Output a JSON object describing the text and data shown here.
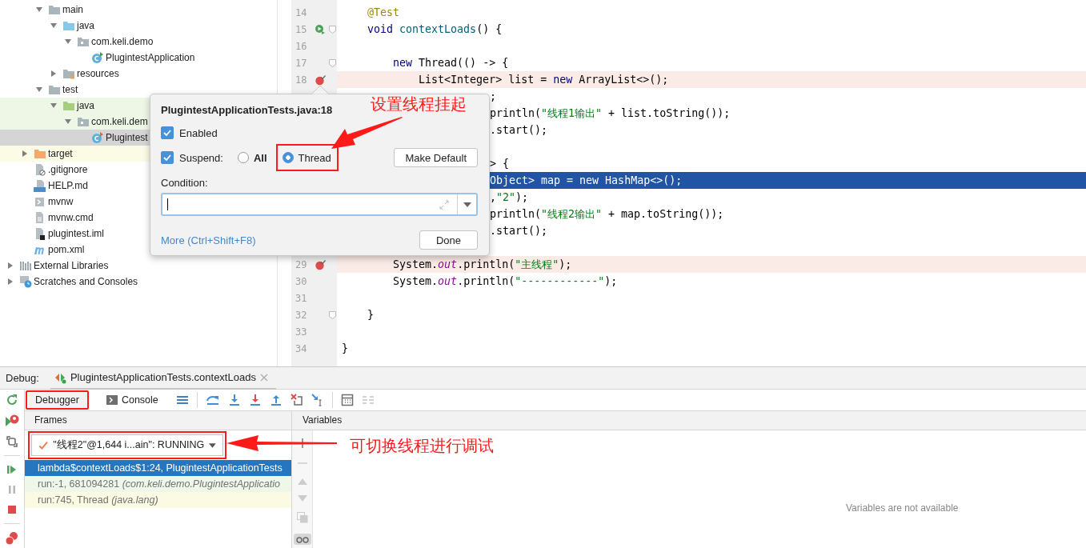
{
  "tree": {
    "src_items": [
      {
        "label": "main",
        "kind": "folder",
        "expanded": true,
        "selected": false,
        "children": [
          {
            "label": "java",
            "kind": "source-folder",
            "expanded": true,
            "selected": false,
            "children": [
              {
                "label": "com.keli.demo",
                "kind": "package",
                "expanded": true,
                "selected": false,
                "children": [
                  {
                    "label": "PlugintestApplication",
                    "kind": "class",
                    "selected": false
                  }
                ]
              }
            ]
          },
          {
            "label": "resources",
            "kind": "resources-folder",
            "expanded": false,
            "selected": false
          }
        ]
      },
      {
        "label": "test",
        "kind": "folder",
        "expanded": true,
        "selected": false,
        "children": [
          {
            "label": "java",
            "kind": "test-folder",
            "expanded": true,
            "selected": false,
            "test_scope": true,
            "children": [
              {
                "label": "com.keli.dem",
                "kind": "package",
                "expanded": true,
                "selected": false,
                "test_scope": true,
                "children": [
                  {
                    "label": "Plugintest",
                    "kind": "test-class",
                    "selected": true
                  }
                ]
              }
            ]
          }
        ]
      }
    ],
    "module_items": [
      {
        "label": "target",
        "kind": "excluded-folder",
        "expanded": false,
        "selected": false,
        "excluded": true
      },
      {
        "label": ".gitignore",
        "kind": "ignore-file",
        "selected": false
      },
      {
        "label": "HELP.md",
        "kind": "markdown",
        "selected": false
      },
      {
        "label": "mvnw",
        "kind": "script",
        "selected": false
      },
      {
        "label": "mvnw.cmd",
        "kind": "text",
        "selected": false
      },
      {
        "label": "plugintest.iml",
        "kind": "module",
        "selected": false
      },
      {
        "label": "pom.xml",
        "kind": "maven",
        "selected": false
      }
    ],
    "root_items": [
      {
        "label": "External Libraries",
        "kind": "library",
        "expanded": false,
        "selected": false
      },
      {
        "label": "Scratches and Consoles",
        "kind": "scratches",
        "expanded": false,
        "selected": false
      }
    ]
  },
  "editor": {
    "lines": [
      {
        "number": "14",
        "code": [
          {
            "text": "    @Test",
            "kind": "ann"
          }
        ]
      },
      {
        "number": "15",
        "run_marker": true,
        "fold": true,
        "code": [
          {
            "text": "    void ",
            "kind": "kw"
          },
          {
            "text": "contextLoads",
            "kind": "fn"
          },
          {
            "text": "() {",
            "kind": "plain"
          }
        ]
      },
      {
        "number": "16"
      },
      {
        "number": "17",
        "fold": true,
        "code": [
          {
            "text": "        new ",
            "kind": "kw"
          },
          {
            "text": "Thread(() -> {",
            "kind": "plain"
          }
        ]
      },
      {
        "number": "18",
        "breakpoint": true,
        "code": [
          {
            "text": "            List<Integer> list = ",
            "kind": "plain"
          },
          {
            "text": "new ",
            "kind": "kw"
          },
          {
            "text": "ArrayList<>();",
            "kind": "plain"
          }
        ]
      },
      {
        "kind": "partial",
        "code": [
          {
            "text": ";",
            "kind": "plain"
          }
        ]
      },
      {
        "kind": "partial",
        "code": [
          {
            "text": "println(",
            "kind": "plain"
          },
          {
            "text": "\"线程1输出\"",
            "kind": "str"
          },
          {
            "text": " + list.toString());",
            "kind": "plain"
          }
        ]
      },
      {
        "kind": "partial",
        "code": [
          {
            "text": ".start();",
            "kind": "plain"
          }
        ]
      },
      {
        "kind": "partial"
      },
      {
        "kind": "partial",
        "code": [
          {
            "text": "> {",
            "kind": "plain"
          }
        ]
      },
      {
        "kind": "partial",
        "current": true,
        "code": [
          {
            "text": "Object> map = ",
            "kind": "plain"
          },
          {
            "text": "new ",
            "kind": "kw"
          },
          {
            "text": "HashMap<>();",
            "kind": "plain"
          }
        ]
      },
      {
        "kind": "partial",
        "code": [
          {
            "text": ",",
            "kind": "plain"
          },
          {
            "text": "\"2\"",
            "kind": "str"
          },
          {
            "text": ");",
            "kind": "plain"
          }
        ]
      },
      {
        "kind": "partial",
        "code": [
          {
            "text": "println(",
            "kind": "plain"
          },
          {
            "text": "\"线程2输出\"",
            "kind": "str"
          },
          {
            "text": " + map.toString());",
            "kind": "plain"
          }
        ]
      },
      {
        "kind": "partial",
        "code": [
          {
            "text": ".start();",
            "kind": "plain"
          }
        ]
      },
      {
        "kind": "partial"
      },
      {
        "number": "29",
        "breakpoint": true,
        "code": [
          {
            "text": "        System.",
            "kind": "plain"
          },
          {
            "text": "out",
            "kind": "field"
          },
          {
            "text": ".println(",
            "kind": "plain"
          },
          {
            "text": "\"主线程\"",
            "kind": "str"
          },
          {
            "text": ");",
            "kind": "plain"
          }
        ]
      },
      {
        "number": "30",
        "code": [
          {
            "text": "        System.",
            "kind": "plain"
          },
          {
            "text": "out",
            "kind": "field"
          },
          {
            "text": ".println(",
            "kind": "plain"
          },
          {
            "text": "\"------------\"",
            "kind": "str"
          },
          {
            "text": ");",
            "kind": "plain"
          }
        ]
      },
      {
        "number": "31"
      },
      {
        "number": "32",
        "fold": true,
        "code": [
          {
            "text": "    }",
            "kind": "plain"
          }
        ]
      },
      {
        "number": "33"
      },
      {
        "number": "34",
        "code": [
          {
            "text": "}",
            "kind": "plain"
          }
        ]
      }
    ]
  },
  "popup": {
    "title": "PlugintestApplicationTests.java:18",
    "enabled": {
      "label": "Enabled",
      "checked": true
    },
    "suspend": {
      "label": "Suspend:",
      "checked": true
    },
    "suspend_options": [
      {
        "label": "All",
        "selected": false,
        "annotated": false
      },
      {
        "label": "Thread",
        "selected": true,
        "annotated": true
      }
    ],
    "make_default_button": "Make Default",
    "condition_label": "Condition:",
    "more_link": "More (Ctrl+Shift+F8)",
    "done_button": "Done"
  },
  "debug": {
    "label": "Debug:",
    "session_tab": "PlugintestApplicationTests.contextLoads",
    "tabs": [
      {
        "label": "Debugger",
        "selected": true,
        "annotated": true
      },
      {
        "label": "Console",
        "selected": false,
        "annotated": false
      }
    ],
    "frames_header": "Frames",
    "thread_dropdown": {
      "value": "\"线程2\"@1,644 i...ain\": RUNNING",
      "annotated": true
    },
    "frames": [
      {
        "text": "lambda$contextLoads$1:24, PlugintestApplicationTests",
        "selected": true
      },
      {
        "text": "run:-1, 681094281 *(com.keli.demo.PlugintestApplicatio*",
        "selected": false,
        "kind": "test"
      },
      {
        "text": "run:745, Thread *(java.lang)*",
        "selected": false,
        "kind": "library"
      }
    ],
    "variables_header": "Variables",
    "variables_empty": "Variables are not available"
  },
  "annotations": [
    {
      "text": "设置线程挂起"
    },
    {
      "text": "可切换线程进行调试"
    }
  ]
}
